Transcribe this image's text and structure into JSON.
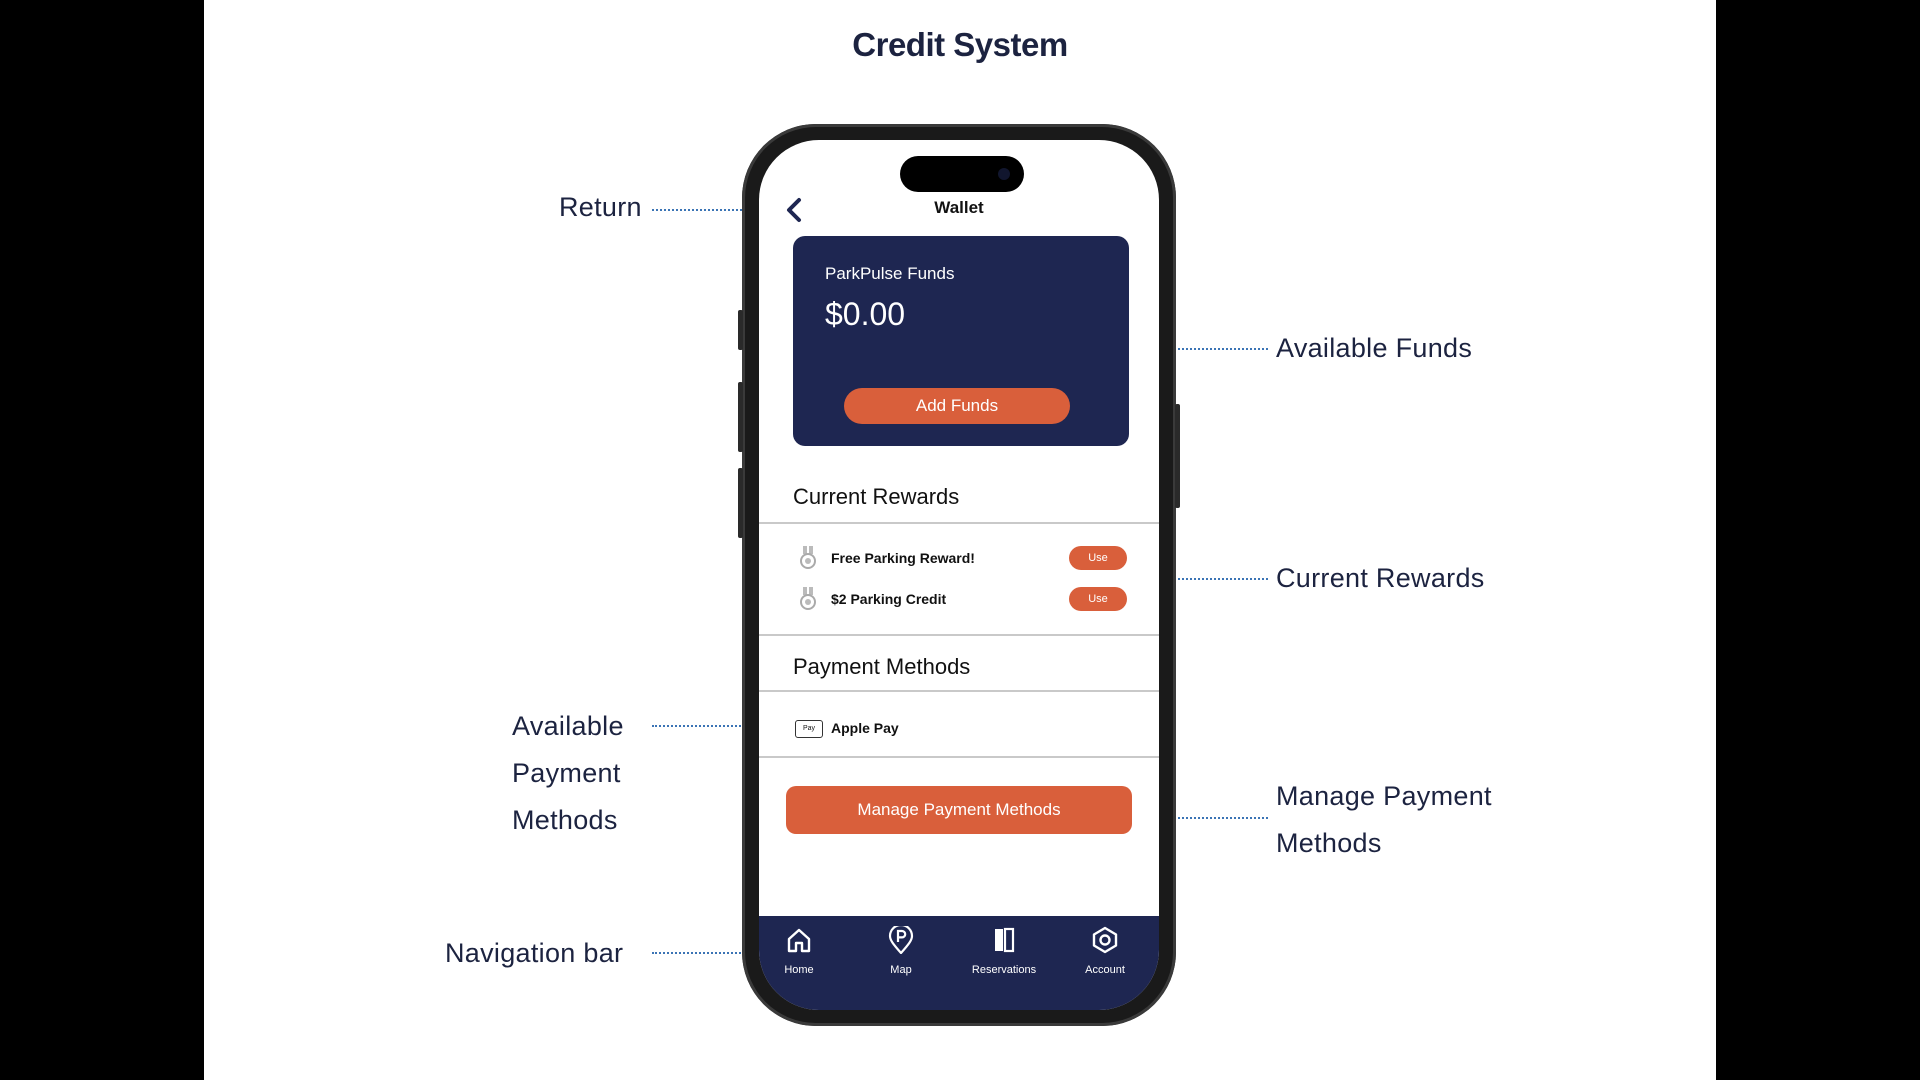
{
  "slide": {
    "title": "Credit System",
    "annotations": {
      "return": "Return",
      "available_funds": "Available Funds",
      "current_rewards": "Current Rewards",
      "available_payment_methods": [
        "Available",
        "Payment",
        "Methods"
      ],
      "manage_payment_methods": [
        "Manage Payment",
        "Methods"
      ],
      "navigation_bar": "Navigation bar"
    }
  },
  "app": {
    "header": {
      "title": "Wallet",
      "back_icon": "chevron-left-icon"
    },
    "funds_card": {
      "label": "ParkPulse Funds",
      "value": "$0.00",
      "button": "Add Funds"
    },
    "rewards": {
      "title": "Current Rewards",
      "items": [
        {
          "label": "Free Parking Reward!",
          "button": "Use",
          "icon": "medal-icon"
        },
        {
          "label": "$2 Parking Credit",
          "button": "Use",
          "icon": "medal-icon"
        }
      ]
    },
    "payment": {
      "title": "Payment Methods",
      "items": [
        {
          "label": "Apple Pay",
          "icon_text": "Pay",
          "icon": "apple-pay-icon"
        }
      ],
      "manage_button": "Manage Payment Methods"
    },
    "nav": [
      {
        "label": "Home",
        "icon": "home-icon"
      },
      {
        "label": "Map",
        "icon": "parking-pin-icon"
      },
      {
        "label": "Reservations",
        "icon": "reservations-icon"
      },
      {
        "label": "Account",
        "icon": "account-hexagon-icon"
      }
    ]
  },
  "colors": {
    "navy": "#1e2651",
    "accent": "#d95f3b",
    "annotation_line": "#3b74b5"
  }
}
